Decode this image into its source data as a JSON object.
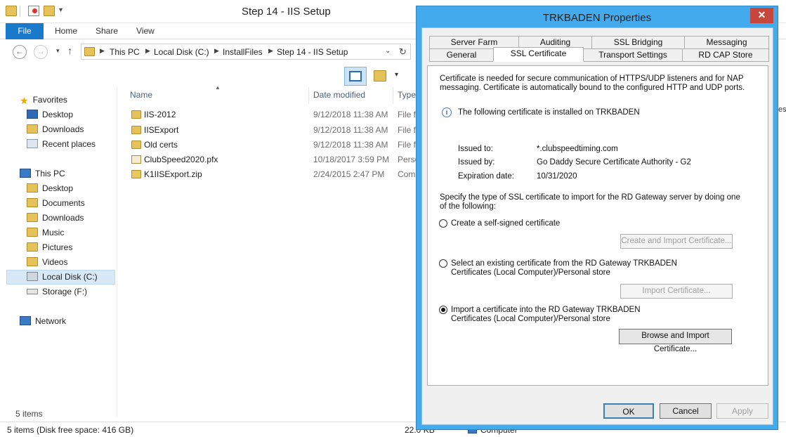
{
  "explorer": {
    "title": "Step 14 - IIS Setup",
    "ribbon_tabs": [
      "File",
      "Home",
      "Share",
      "View"
    ],
    "breadcrumb": [
      "This PC",
      "Local Disk (C:)",
      "InstallFiles",
      "Step 14 - IIS Setup"
    ],
    "nav": {
      "favorites_label": "Favorites",
      "favorites": [
        "Desktop",
        "Downloads",
        "Recent places"
      ],
      "this_pc_label": "This PC",
      "this_pc": [
        "Desktop",
        "Documents",
        "Downloads",
        "Music",
        "Pictures",
        "Videos",
        "Local Disk (C:)",
        "Storage (F:)"
      ],
      "network_label": "Network"
    },
    "columns": {
      "name": "Name",
      "date": "Date modified",
      "type": "Type"
    },
    "files": [
      {
        "name": "IIS-2012",
        "date": "9/12/2018 11:38 AM",
        "type": "File f",
        "icon": "folder-icon"
      },
      {
        "name": "IISExport",
        "date": "9/12/2018 11:38 AM",
        "type": "File f",
        "icon": "folder-icon"
      },
      {
        "name": "Old certs",
        "date": "9/12/2018 11:38 AM",
        "type": "File f",
        "icon": "folder-icon"
      },
      {
        "name": "ClubSpeed2020.pfx",
        "date": "10/18/2017 3:59 PM",
        "type": "Perso",
        "icon": "certificate-file-icon"
      },
      {
        "name": "K1IISExport.zip",
        "date": "2/24/2015 2:47 PM",
        "type": "Com",
        "icon": "zip-file-icon"
      }
    ],
    "item_count": "5 items",
    "status_left": "5 items (Disk free space: 416 GB)",
    "status_size": "22.0 KB",
    "status_computer": "Computer"
  },
  "dialog": {
    "title": "TRKBADEN Properties",
    "close_label": "✕",
    "tabs_row1": [
      "Server Farm",
      "Auditing",
      "SSL Bridging",
      "Messaging"
    ],
    "tabs_row2": [
      "General",
      "SSL Certificate",
      "Transport Settings",
      "RD CAP Store"
    ],
    "active_tab": "SSL Certificate",
    "intro": "Certificate is needed for secure communication of HTTPS/UDP listeners and for NAP messaging. Certificate is automatically bound to the configured HTTP and UDP ports.",
    "installed_text": "The following certificate is installed on TRKBADEN",
    "cert": {
      "issued_to_label": "Issued to:",
      "issued_to": "*.clubspeedtiming.com",
      "issued_by_label": "Issued by:",
      "issued_by": "Go Daddy Secure Certificate Authority - G2",
      "expiration_label": "Expiration date:",
      "expiration": "10/31/2020"
    },
    "specify_text": "Specify the type of SSL certificate to import for the RD Gateway server by doing one of the following:",
    "options": [
      {
        "label": "Create a self-signed certificate",
        "button": "Create and Import Certificate...",
        "selected": false
      },
      {
        "label": "Select an existing certificate from the RD Gateway TRKBADEN Certificates (Local Computer)/Personal store",
        "button": "Import Certificate...",
        "selected": false
      },
      {
        "label": "Import a certificate into the RD Gateway TRKBADEN Certificates (Local Computer)/Personal store",
        "button": "Browse and Import Certificate...",
        "selected": true
      }
    ],
    "ok": "OK",
    "cancel": "Cancel",
    "apply": "Apply"
  },
  "colors": {
    "accent": "#1979ca",
    "dialog_frame": "#44aaee",
    "close": "#c7473f"
  }
}
